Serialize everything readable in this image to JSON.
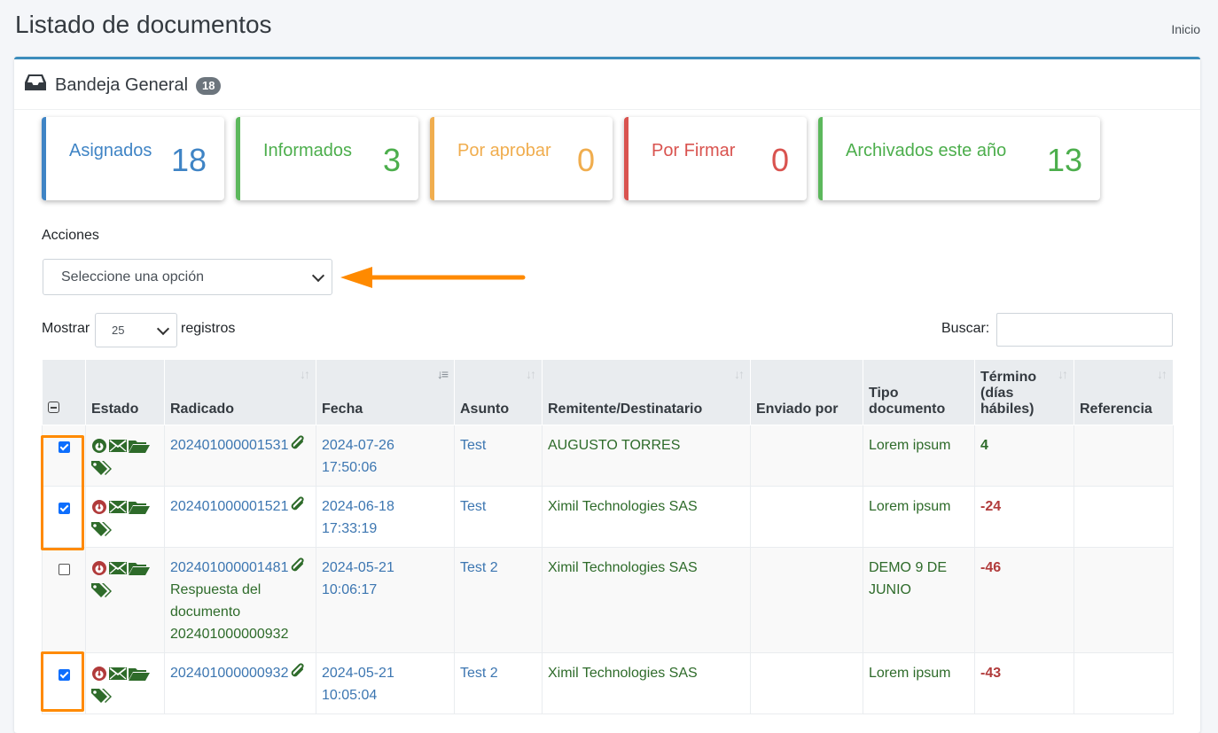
{
  "page": {
    "title": "Listado de documentos",
    "breadcrumb": "Inicio"
  },
  "inbox": {
    "title": "Bandeja General",
    "count": "18"
  },
  "stats": [
    {
      "label": "Asignados",
      "value": "18",
      "color": "#3f84c5"
    },
    {
      "label": "Informados",
      "value": "3",
      "color": "#5cb85c"
    },
    {
      "label": "Por aprobar",
      "value": "0",
      "color": "#f0ad4e"
    },
    {
      "label": "Por Firmar",
      "value": "0",
      "color": "#d9534f"
    },
    {
      "label": "Archivados este año",
      "value": "13",
      "color": "#5cb85c"
    }
  ],
  "actions": {
    "label": "Acciones",
    "selected": "Seleccione una opción"
  },
  "table_controls": {
    "show_label": "Mostrar",
    "page_length": "25",
    "records_label": "registros",
    "search_label": "Buscar:"
  },
  "table": {
    "headers": {
      "estado": "Estado",
      "radicado": "Radicado",
      "fecha": "Fecha",
      "asunto": "Asunto",
      "remitente": "Remitente/Destinatario",
      "enviado": "Enviado por",
      "tipo": "Tipo documento",
      "termino": "Término (días hábiles)",
      "referencia": "Referencia"
    },
    "rows": [
      {
        "checked": true,
        "status": "green",
        "radicado": "202401000001531",
        "note": "",
        "fecha": "2024-07-26 17:50:06",
        "asunto": "Test",
        "remitente": "AUGUSTO TORRES",
        "enviado": "",
        "tipo": "Lorem ipsum",
        "termino": "4",
        "referencia": ""
      },
      {
        "checked": true,
        "status": "red",
        "radicado": "202401000001521",
        "note": "",
        "fecha": "2024-06-18 17:33:19",
        "asunto": "Test",
        "remitente": "Ximil Technologies SAS",
        "enviado": "",
        "tipo": "Lorem ipsum",
        "termino": "-24",
        "referencia": ""
      },
      {
        "checked": false,
        "status": "red",
        "radicado": "202401000001481",
        "note": "Respuesta del documento 202401000000932",
        "fecha": "2024-05-21 10:06:17",
        "asunto": "Test 2",
        "remitente": "Ximil Technologies SAS",
        "enviado": "",
        "tipo": "DEMO 9 DE JUNIO",
        "termino": "-46",
        "referencia": ""
      },
      {
        "checked": true,
        "status": "red",
        "radicado": "202401000000932",
        "note": "",
        "fecha": "2024-05-21 10:05:04",
        "asunto": "Test 2",
        "remitente": "Ximil Technologies SAS",
        "enviado": "",
        "tipo": "Lorem ipsum",
        "termino": "-43",
        "referencia": ""
      }
    ]
  },
  "icons": {
    "inbox": "inbox-icon",
    "attachment": "paperclip-icon",
    "email": "envelope-icon",
    "folder": "folder-open-icon",
    "tags": "tags-icon",
    "status": "clock-face-icon"
  },
  "colors": {
    "accent": "#3c8dbc",
    "highlight": "#ff8a00",
    "status_green": "#2e6b2a",
    "status_red": "#b13b3b"
  }
}
